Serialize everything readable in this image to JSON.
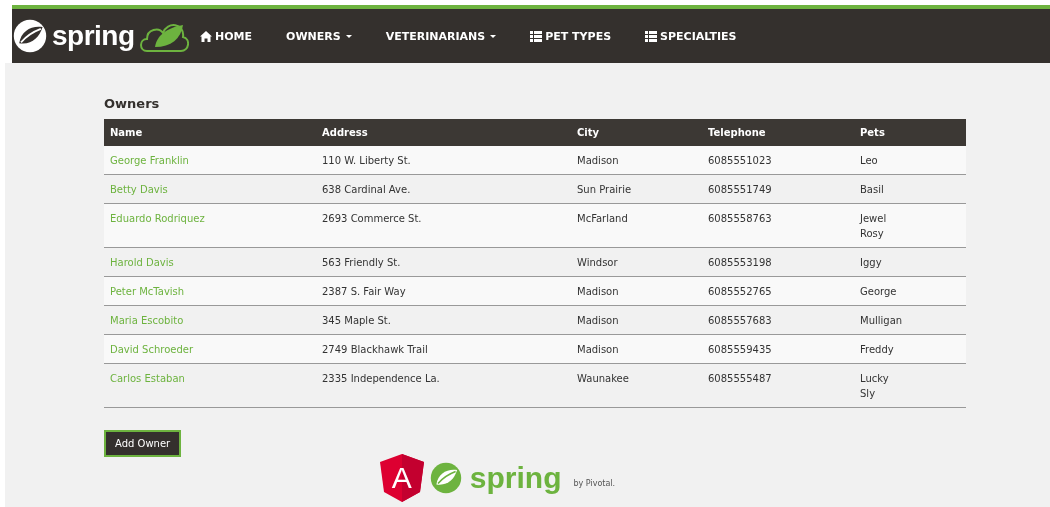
{
  "brand": {
    "logo_text": "spring"
  },
  "nav": [
    {
      "label": "HOME",
      "kind": "home",
      "dropdown": false
    },
    {
      "label": "OWNERS",
      "kind": "plain",
      "dropdown": true
    },
    {
      "label": "VETERINARIANS",
      "kind": "plain",
      "dropdown": true
    },
    {
      "label": "PET TYPES",
      "kind": "list",
      "dropdown": false
    },
    {
      "label": "SPECIALTIES",
      "kind": "list",
      "dropdown": false
    }
  ],
  "heading": "Owners",
  "table": {
    "columns": [
      "Name",
      "Address",
      "City",
      "Telephone",
      "Pets"
    ],
    "rows": [
      {
        "name": "George Franklin",
        "address": "110 W. Liberty St.",
        "city": "Madison",
        "telephone": "6085551023",
        "pets": [
          "Leo"
        ]
      },
      {
        "name": "Betty Davis",
        "address": "638 Cardinal Ave.",
        "city": "Sun Prairie",
        "telephone": "6085551749",
        "pets": [
          "Basil"
        ]
      },
      {
        "name": "Eduardo Rodriquez",
        "address": "2693 Commerce St.",
        "city": "McFarland",
        "telephone": "6085558763",
        "pets": [
          "Jewel",
          "Rosy"
        ]
      },
      {
        "name": "Harold Davis",
        "address": "563 Friendly St.",
        "city": "Windsor",
        "telephone": "6085553198",
        "pets": [
          "Iggy"
        ]
      },
      {
        "name": "Peter McTavish",
        "address": "2387 S. Fair Way",
        "city": "Madison",
        "telephone": "6085552765",
        "pets": [
          "George"
        ]
      },
      {
        "name": "Maria Escobito",
        "address": "345 Maple St.",
        "city": "Madison",
        "telephone": "6085557683",
        "pets": [
          "Mulligan"
        ]
      },
      {
        "name": "David Schroeder",
        "address": "2749 Blackhawk Trail",
        "city": "Madison",
        "telephone": "6085559435",
        "pets": [
          "Freddy"
        ]
      },
      {
        "name": "Carlos Estaban",
        "address": "2335 Independence La.",
        "city": "Waunakee",
        "telephone": "6085555487",
        "pets": [
          "Lucky",
          "Sly"
        ]
      }
    ]
  },
  "add_button": "Add Owner",
  "footer": {
    "angular_letter": "A",
    "spring_text": "spring",
    "byline": "by Pivotal."
  }
}
